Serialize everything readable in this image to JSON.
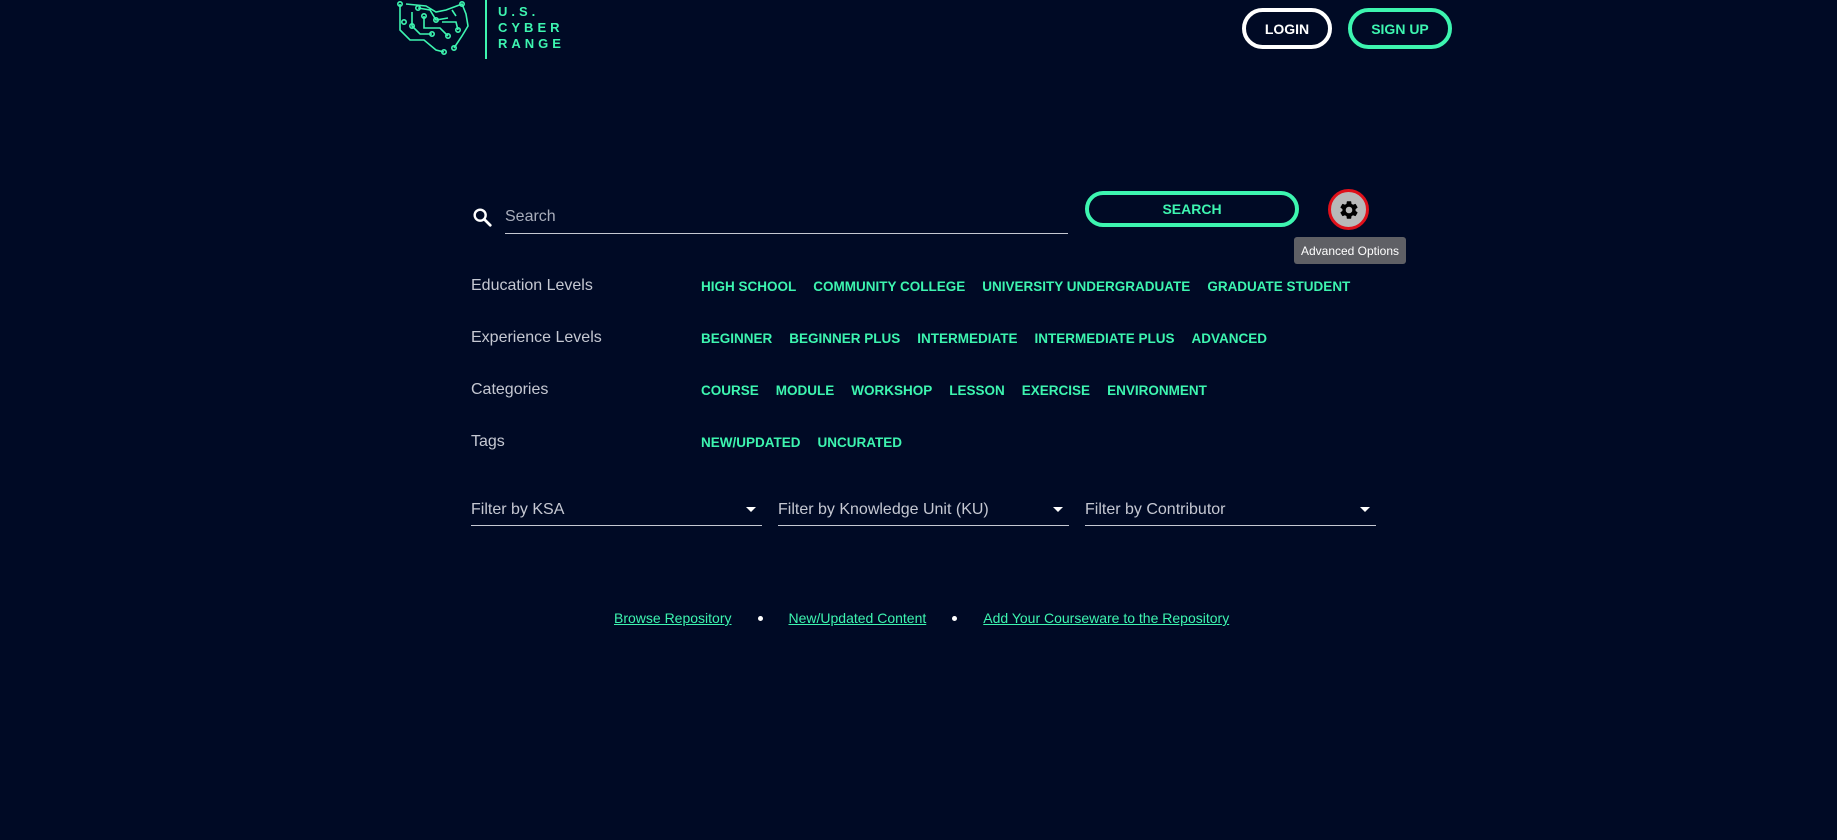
{
  "header": {
    "logo_lines": [
      "U.S.",
      "CYBER",
      "RANGE"
    ],
    "login_label": "LOGIN",
    "signup_label": "SIGN UP"
  },
  "search": {
    "placeholder": "Search",
    "value": "",
    "button_label": "SEARCH",
    "advanced_icon": "gear-icon",
    "advanced_tooltip": "Advanced Options"
  },
  "filters": {
    "rows": [
      {
        "label": "Education Levels",
        "chips": [
          "HIGH SCHOOL",
          "COMMUNITY COLLEGE",
          "UNIVERSITY UNDERGRADUATE",
          "GRADUATE STUDENT"
        ]
      },
      {
        "label": "Experience Levels",
        "chips": [
          "BEGINNER",
          "BEGINNER PLUS",
          "INTERMEDIATE",
          "INTERMEDIATE PLUS",
          "ADVANCED"
        ]
      },
      {
        "label": "Categories",
        "chips": [
          "COURSE",
          "MODULE",
          "WORKSHOP",
          "LESSON",
          "EXERCISE",
          "ENVIRONMENT"
        ]
      },
      {
        "label": "Tags",
        "chips": [
          "NEW/UPDATED",
          "UNCURATED"
        ]
      }
    ],
    "dropdowns": [
      "Filter by KSA",
      "Filter by Knowledge Unit (KU)",
      "Filter by Contributor"
    ]
  },
  "footer_links": [
    "Browse Repository",
    "New/Updated Content",
    "Add Your Courseware to the Repository"
  ],
  "colors": {
    "background": "#000a25",
    "accent": "#3df5b0",
    "highlight": "#e0101a"
  }
}
